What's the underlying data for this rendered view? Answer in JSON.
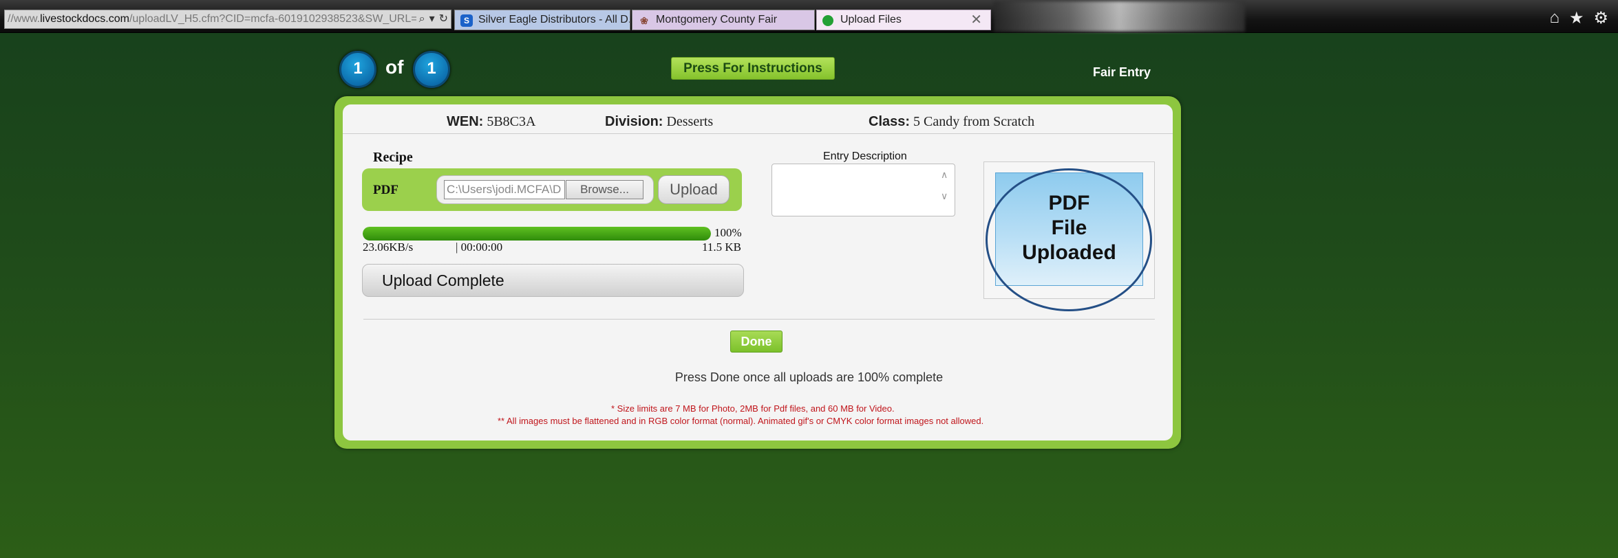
{
  "browser": {
    "address_prefix": "//www.",
    "address_host": "livestockdocs.com",
    "address_path": "/uploadLV_H5.cfm?CID=mcfa-6019102938523&SW_URL=",
    "tabs": [
      {
        "label": "Silver Eagle Distributors - All D...",
        "icon": "s-logo-icon"
      },
      {
        "label": "Montgomery County Fair",
        "icon": "fair-icon"
      },
      {
        "label": "Upload Files",
        "icon": "green-dot-icon",
        "active": true
      }
    ],
    "right_icons": [
      "home-icon",
      "star-icon",
      "gear-icon"
    ]
  },
  "header": {
    "page_current": "1",
    "of_label": "of",
    "page_total": "1",
    "instructions_label": "Press For Instructions",
    "fair_entry_label": "Fair Entry"
  },
  "entry": {
    "wen_label": "WEN:",
    "wen_value": "5B8C3A",
    "division_label": "Division:",
    "division_value": "Desserts",
    "class_label": "Class:",
    "class_value": "5 Candy from Scratch"
  },
  "upload": {
    "section_label": "Recipe",
    "type_label": "PDF",
    "file_value": "C:\\Users\\jodi.MCFA\\D",
    "browse_label": "Browse...",
    "upload_label": "Upload",
    "progress_percent": 100,
    "progress_text": "100%",
    "speed": "23.06KB/s",
    "time": "| 00:00:00",
    "size": "11.5 KB",
    "status": "Upload Complete"
  },
  "description": {
    "label": "Entry Description",
    "value": ""
  },
  "thumbnail": {
    "line1": "PDF",
    "line2": "File",
    "line3": "Uploaded"
  },
  "footer": {
    "done_label": "Done",
    "done_note": "Press Done once all uploads are 100% complete",
    "note1": "* Size limits are 7 MB for Photo, 2MB for Pdf files, and 60 MB for Video.",
    "note2": "** All images must be flattened and in RGB color format (normal).  Animated gif's or CMYK color format images not allowed."
  },
  "colors": {
    "panel_green": "#8dc63f",
    "accent_blue": "#0d6fae",
    "note_red": "#c0151b"
  }
}
